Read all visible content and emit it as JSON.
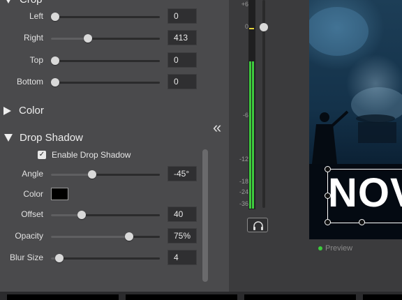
{
  "inspector": {
    "crop": {
      "title": "Crop",
      "rows": [
        {
          "label": "Left",
          "value": "0",
          "slider": 0.0
        },
        {
          "label": "Right",
          "value": "413",
          "slider": 0.34
        },
        {
          "label": "Top",
          "value": "0",
          "slider": 0.0
        },
        {
          "label": "Bottom",
          "value": "0",
          "slider": 0.0
        }
      ]
    },
    "color_section": {
      "title": "Color"
    },
    "drop_shadow": {
      "title": "Drop Shadow",
      "enable_label": "Enable Drop Shadow",
      "enabled": true,
      "angle": {
        "label": "Angle",
        "value": "-45°",
        "slider": 0.38
      },
      "color": {
        "label": "Color",
        "swatch": "#000000"
      },
      "offset": {
        "label": "Offset",
        "value": "40",
        "slider": 0.28
      },
      "opacity": {
        "label": "Opacity",
        "value": "75%",
        "slider": 0.72
      },
      "blur": {
        "label": "Blur Size",
        "value": "4",
        "slider": 0.08
      }
    }
  },
  "collapse_glyph": "«",
  "meter": {
    "scale": [
      "+6",
      "0",
      "-6",
      "-12",
      "-18",
      "-24",
      "-36"
    ],
    "level_fraction": 0.71,
    "volume_fraction": 0.13
  },
  "preview": {
    "overlay_text": "NOV",
    "status": "Preview"
  },
  "colors": {
    "meter_green": "#3dcc3d",
    "peak_yellow": "#e6d43a",
    "status_green": "#3dcc3d"
  }
}
